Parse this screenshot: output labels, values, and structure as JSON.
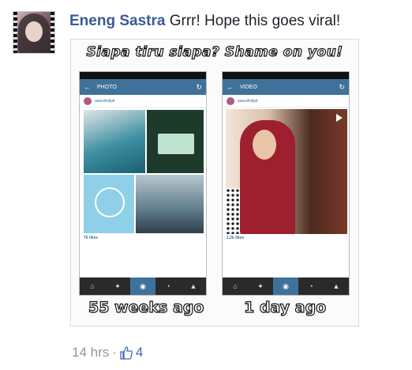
{
  "comment": {
    "author": "Eneng Sastra",
    "text": "Grrr! Hope this goes viral!",
    "time": "14 hrs",
    "separator": "·",
    "like_count": "4"
  },
  "image": {
    "banner": "Siapa tiru siapa? Shame on you!",
    "left_phone": {
      "screen_title": "PHOTO",
      "caption": "55 weeks ago",
      "username": "aaarafsiljab",
      "likes": "76 likes"
    },
    "right_phone": {
      "screen_title": "VIDEO",
      "caption": "1 day ago",
      "username": "aaarafsiljab",
      "likes": "1,2k likes"
    }
  },
  "icons": {
    "like": "thumbs-up-icon",
    "back": "arrow-left-icon",
    "refresh": "refresh-icon"
  },
  "colors": {
    "author_link": "#3b5998",
    "like_blue": "#4267b2",
    "meta_grey": "#90949c",
    "instagram_bar": "#3f729b"
  }
}
